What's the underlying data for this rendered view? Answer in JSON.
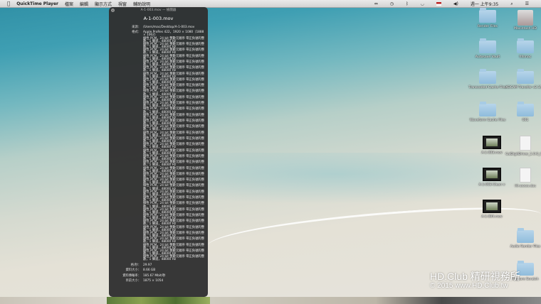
{
  "menubar": {
    "apple": "",
    "app": "QuickTime Player",
    "items": [
      "檔案",
      "編輯",
      "顯示方式",
      "視窗",
      "輔助說明"
    ],
    "clock": "週一 上午9:35"
  },
  "inspector": {
    "window_title": "A-1-003.mov — 檢閱器",
    "file_name": "A-1-003.mov",
    "source_label": "來源：",
    "source_value": "/Users/mac/Desktop/A-1-003.mov",
    "format_label": "格式：",
    "format_video": "Apple ProRes 422，1920 × 1080（1888 × 1062）",
    "audio_tracks": [
      "線性 PCM，24 bit 整數元順序 帶正負號的整數，1 聲道，48000 Hz",
      "線性 PCM，24 bit 整數元順序 帶正負號的整數，1 聲道，48000 Hz",
      "線性 PCM，24 bit 整數元順序 帶正負號的整數，1 聲道，48000 Hz",
      "線性 PCM，24 bit 整數元順序 帶正負號的整數，1 聲道，48000 Hz",
      "線性 PCM，24 bit 整數元順序 帶正負號的整數，1 聲道，48000 Hz",
      "線性 PCM，24 bit 整數元順序 帶正負號的整數，1 聲道，48000 Hz",
      "線性 PCM，24 bit 整數元順序 帶正負號的整數，1 聲道，48000 Hz",
      "線性 PCM，24 bit 整數元順序 帶正負號的整數，1 聲道，48000 Hz",
      "線性 PCM，24 bit 整數元順序 帶正負號的整數，1 聲道，48000 Hz",
      "線性 PCM，24 bit 整數元順序 帶正負號的整數，1 聲道，48000 Hz",
      "線性 PCM，24 bit 整數元順序 帶正負號的整數，1 聲道，48000 Hz",
      "線性 PCM，24 bit 整數元順序 帶正負號的整數，1 聲道，48000 Hz",
      "線性 PCM，24 bit 整數元順序 帶正負號的整數，1 聲道，48000 Hz",
      "線性 PCM，24 bit 整數元順序 帶正負號的整數，1 聲道，48000 Hz",
      "線性 PCM，24 bit 整數元順序 帶正負號的整數，1 聲道，48000 Hz",
      "線性 PCM，24 bit 整數元順序 帶正負號的整數，1 聲道，48000 Hz",
      "線性 PCM，24 bit 整數元順序 帶正負號的整數，1 聲道，48000 Hz",
      "線性 PCM，24 bit 整數元順序 帶正負號的整數，1 聲道，48000 Hz",
      "線性 PCM，24 bit 整數元順序 帶正負號的整數，1 聲道，48000 Hz",
      "線性 PCM，24 bit 整數元順序 帶正負號的整數，1 聲道，48000 Hz",
      "線性 PCM，24 bit 整數元順序 帶正負號的整數，1 聲道，48000 Hz",
      "線性 PCM，24 bit 整數元順序 帶正負號的整數，1 聲道，48000 Hz",
      "線性 PCM，24 bit 整數元順序 帶正負號的整數，1 聲道，48000 Hz",
      "線性 PCM，24 bit 整數元順序 帶正負號的整數，1 聲道，48000 Hz",
      "線性 PCM，24 bit 整數元順序 帶正負號的整數，1 聲道，48000 Hz",
      "線性 PCM，24 bit 整數元順序 帶正負號的整數，1 聲道，48000 Hz",
      "線性 PCM，24 bit 整數元順序 帶正負號的整數，1 聲道，48000 Hz",
      "線性 PCM，24 bit 整數元順序 帶正負號的整數，1 聲道，48000 Hz",
      "線性 PCM，24 bit 整數元順序 帶正負號的整數，1 聲道，48000 Hz",
      "線性 PCM，24 bit 整數元順序 帶正負號的整數，1 聲道，48000 Hz",
      "線性 PCM，24 bit 整數元順序 帶正負號的整數，1 聲道，48000 Hz",
      "線性 PCM，24 bit 整數元順序 帶正負號的整數，1 聲道，48000 Hz",
      "線性 PCM，24 bit 整數元順序 帶正負號的整數，1 聲道，48000 Hz",
      "線性 PCM，24 bit 整數元順序 帶正負號的整數，1 聲道，48000 Hz",
      "線性 PCM，24 bit 整數元順序 帶正負號的整數，1 聲道，48000 Hz",
      "線性 PCM，24 bit 整數元順序 帶正負號的整數，1 聲道，48000 Hz",
      "線性 PCM，24 bit 整數元順序 帶正負號的整數，1 聲道，48000 Hz",
      "線性 PCM，24 bit 整數元順序 帶正負號的整數，1 聲道，48000 Hz"
    ],
    "stats": [
      {
        "label": "格/秒：",
        "value": "29.97"
      },
      {
        "label": "資料大小：",
        "value": "8.66 GB"
      },
      {
        "label": "資料傳輸率：",
        "value": "185.67 Mbit/秒"
      },
      {
        "label": "目前大小：",
        "value": "1875 × 1054"
      }
    ]
  },
  "desktop_icons": [
    {
      "label": "Render Files",
      "type": "folder"
    },
    {
      "label": "Macintosh HD",
      "type": "drive"
    },
    {
      "label": "Autosave Vault",
      "type": "folder"
    },
    {
      "label": "hfsmac",
      "type": "folder"
    },
    {
      "label": "Transcoded Cache Files",
      "type": "folder"
    },
    {
      "label": "XDCAM Transfer v2.15.0",
      "type": "folder"
    },
    {
      "label": "Waveform Cache Files",
      "type": "folder"
    },
    {
      "label": "001",
      "type": "folder"
    },
    {
      "label": "A-1-003.mov",
      "type": "movie"
    },
    {
      "label": "CalDigitDriver_1.0.0_Catalog.dmg",
      "type": "disk-image"
    },
    {
      "label": "A-1-003-Clean v",
      "type": "movie"
    },
    {
      "label": "HI-xxxxx.doc",
      "type": "doc"
    },
    {
      "label": "A-1-004.mov",
      "type": "movie"
    },
    {
      "label": "Audio Render Files",
      "type": "folder"
    },
    {
      "label": "Capture Scratch",
      "type": "folder"
    }
  ],
  "watermark": {
    "line1": "HD.Club 精研視務所",
    "line2": "© 2015  www.HD.Club.tw"
  }
}
